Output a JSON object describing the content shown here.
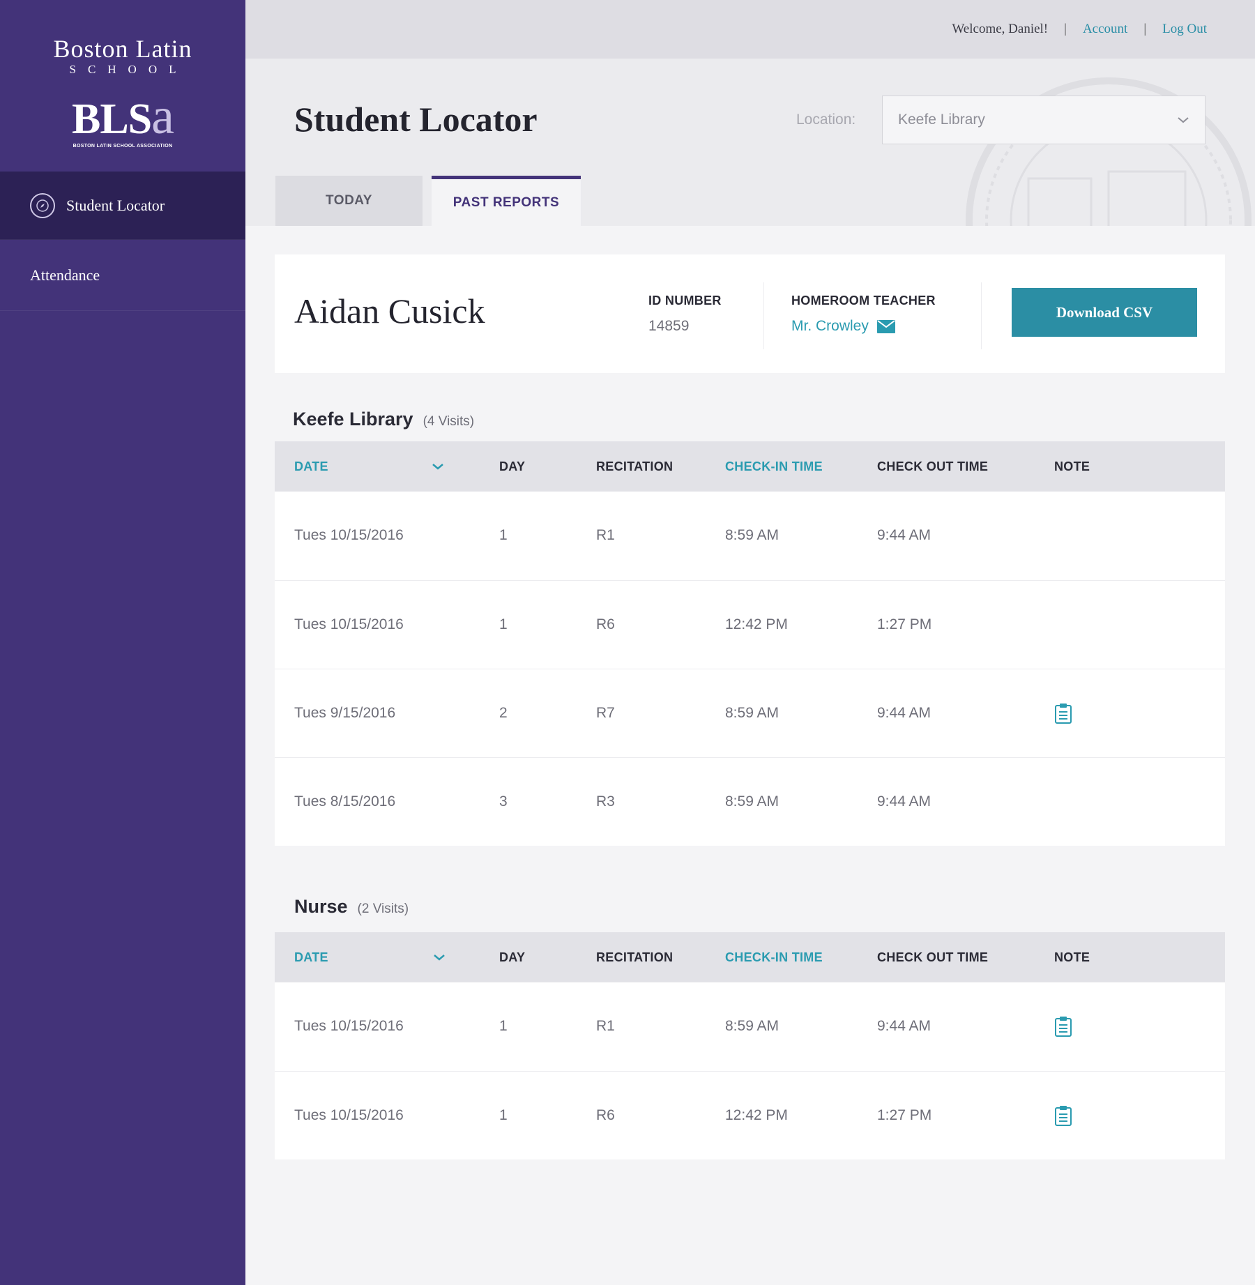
{
  "sidebar": {
    "logo_title": "Boston Latin",
    "logo_subtitle": "SCHOOL",
    "association_logo": "BLSa",
    "association_name": "BOSTON LATIN SCHOOL ASSOCIATION",
    "items": [
      {
        "label": "Student Locator",
        "icon": "compass-icon",
        "active": true
      },
      {
        "label": "Attendance",
        "active": false
      }
    ]
  },
  "topbar": {
    "welcome": "Welcome, Daniel!",
    "separator": "|",
    "account": "Account",
    "logout": "Log Out"
  },
  "header": {
    "title": "Student Locator",
    "location_label": "Location:",
    "location_value": "Keefe Library",
    "tabs": [
      {
        "label": "TODAY",
        "active": false
      },
      {
        "label": "PAST REPORTS",
        "active": true
      }
    ]
  },
  "student": {
    "name": "Aidan Cusick",
    "id_label": "ID NUMBER",
    "id_value": "14859",
    "homeroom_label": "HOMEROOM TEACHER",
    "homeroom_value": "Mr. Crowley",
    "download_label": "Download CSV"
  },
  "columns": {
    "date": "DATE",
    "day": "DAY",
    "recitation": "RECITATION",
    "check_in": "CHECK-IN TIME",
    "check_out": "CHECK OUT TIME",
    "note": "NOTE"
  },
  "sections": [
    {
      "title": "Keefe Library",
      "count": "(4 Visits)",
      "rows": [
        {
          "date": "Tues  10/15/2016",
          "day": "1",
          "recitation": "R1",
          "check_in": "8:59 AM",
          "check_out": "9:44 AM",
          "note": false
        },
        {
          "date": "Tues  10/15/2016",
          "day": "1",
          "recitation": "R6",
          "check_in": "12:42 PM",
          "check_out": "1:27 PM",
          "note": false
        },
        {
          "date": "Tues  9/15/2016",
          "day": "2",
          "recitation": "R7",
          "check_in": "8:59 AM",
          "check_out": "9:44 AM",
          "note": true
        },
        {
          "date": "Tues  8/15/2016",
          "day": "3",
          "recitation": "R3",
          "check_in": "8:59 AM",
          "check_out": "9:44 AM",
          "note": false
        }
      ]
    },
    {
      "title": "Nurse",
      "count": "(2 Visits)",
      "rows": [
        {
          "date": "Tues 10/15/2016",
          "day": "1",
          "recitation": "R1",
          "check_in": "8:59 AM",
          "check_out": "9:44 AM",
          "note": true
        },
        {
          "date": "Tues 10/15/2016",
          "day": "1",
          "recitation": "R6",
          "check_in": "12:42 PM",
          "check_out": "1:27 PM",
          "note": true
        }
      ]
    }
  ],
  "colors": {
    "sidebar": "#433379",
    "sidebar_active": "#2c2155",
    "accent": "#2b8ea4",
    "teal_text": "#2a9bb0"
  }
}
